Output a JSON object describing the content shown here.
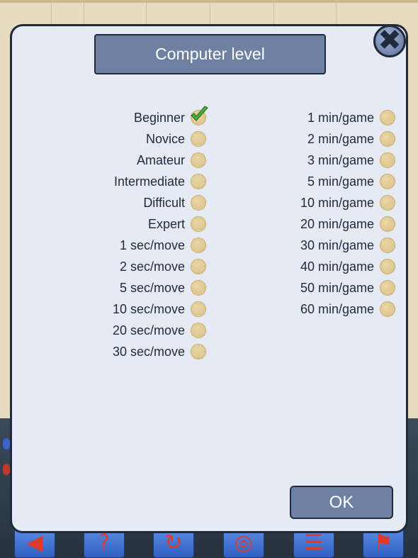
{
  "dialog": {
    "title": "Computer level",
    "close_symbol": "✖",
    "ok_label": "OK"
  },
  "levels": {
    "left": [
      {
        "label": "Beginner",
        "selected": true
      },
      {
        "label": "Novice",
        "selected": false
      },
      {
        "label": "Amateur",
        "selected": false
      },
      {
        "label": "Intermediate",
        "selected": false
      },
      {
        "label": "Difficult",
        "selected": false
      },
      {
        "label": "Expert",
        "selected": false
      },
      {
        "label": "1 sec/move",
        "selected": false
      },
      {
        "label": "2 sec/move",
        "selected": false
      },
      {
        "label": "5 sec/move",
        "selected": false
      },
      {
        "label": "10 sec/move",
        "selected": false
      },
      {
        "label": "20 sec/move",
        "selected": false
      },
      {
        "label": "30 sec/move",
        "selected": false
      }
    ],
    "right": [
      {
        "label": "1 min/game",
        "selected": false
      },
      {
        "label": "2 min/game",
        "selected": false
      },
      {
        "label": "3 min/game",
        "selected": false
      },
      {
        "label": "5 min/game",
        "selected": false
      },
      {
        "label": "10 min/game",
        "selected": false
      },
      {
        "label": "20 min/game",
        "selected": false
      },
      {
        "label": "30 min/game",
        "selected": false
      },
      {
        "label": "40 min/game",
        "selected": false
      },
      {
        "label": "50 min/game",
        "selected": false
      },
      {
        "label": "60 min/game",
        "selected": false
      }
    ]
  },
  "colors": {
    "dialog_bg": "#e6eaf3",
    "button_bg": "#6f81a3",
    "radio": "#e3cc95",
    "check": "#4caf3a",
    "text": "#1f2a3c"
  },
  "toolbar": {
    "icons": [
      "back-arrow-icon",
      "hint-icon",
      "rotate-icon",
      "target-icon",
      "menu-icon",
      "flag-icon"
    ]
  }
}
